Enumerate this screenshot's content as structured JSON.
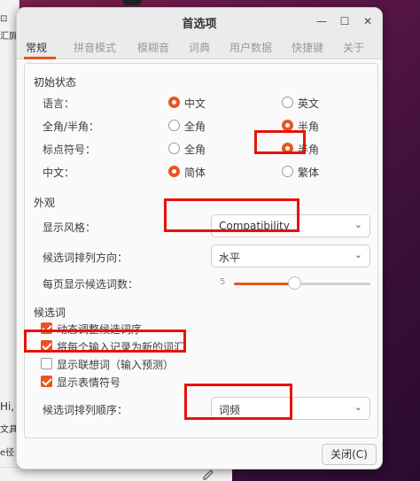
{
  "dialog": {
    "title": "首选项"
  },
  "tabs": [
    {
      "label": "常规"
    },
    {
      "label": "拼音模式"
    },
    {
      "label": "模糊音"
    },
    {
      "label": "词典"
    },
    {
      "label": "用户数据"
    },
    {
      "label": "快捷键"
    },
    {
      "label": "关于"
    }
  ],
  "initial": {
    "section": "初始状态",
    "rows": [
      {
        "label": "语言：",
        "opt1": "中文",
        "opt2": "英文",
        "selected": 1
      },
      {
        "label": "全角/半角：",
        "opt1": "全角",
        "opt2": "半角",
        "selected": 2
      },
      {
        "label": "标点符号：",
        "opt1": "全角",
        "opt2": "半角",
        "selected": 2
      },
      {
        "label": "中文：",
        "opt1": "简体",
        "opt2": "繁体",
        "selected": 1
      }
    ]
  },
  "appearance": {
    "section": "外观",
    "style_label": "显示风格：",
    "style_value": "Compatibility",
    "orient_label": "候选词排列方向：",
    "orient_value": "水平",
    "perpage_label": "每页显示候选词数：",
    "perpage_value": 5
  },
  "candidates": {
    "section": "候选词",
    "checks": [
      {
        "label": "动态调整候选词序",
        "checked": true
      },
      {
        "label": "将每个输入记录为新的词汇",
        "checked": true
      },
      {
        "label": "显示联想词（输入预测）",
        "checked": false
      },
      {
        "label": "显示表情符号",
        "checked": true
      }
    ],
    "sort_label": "候选词排列顺序：",
    "sort_value": "词频"
  },
  "footer": {
    "close_label": "关闭(C)"
  },
  "background": {
    "frag1": "汇屏",
    "frag2": "Hi,",
    "frag3": "文具",
    "frag4": "e径"
  },
  "colors": {
    "accent": "#e95420",
    "annotation": "#e8120c"
  }
}
